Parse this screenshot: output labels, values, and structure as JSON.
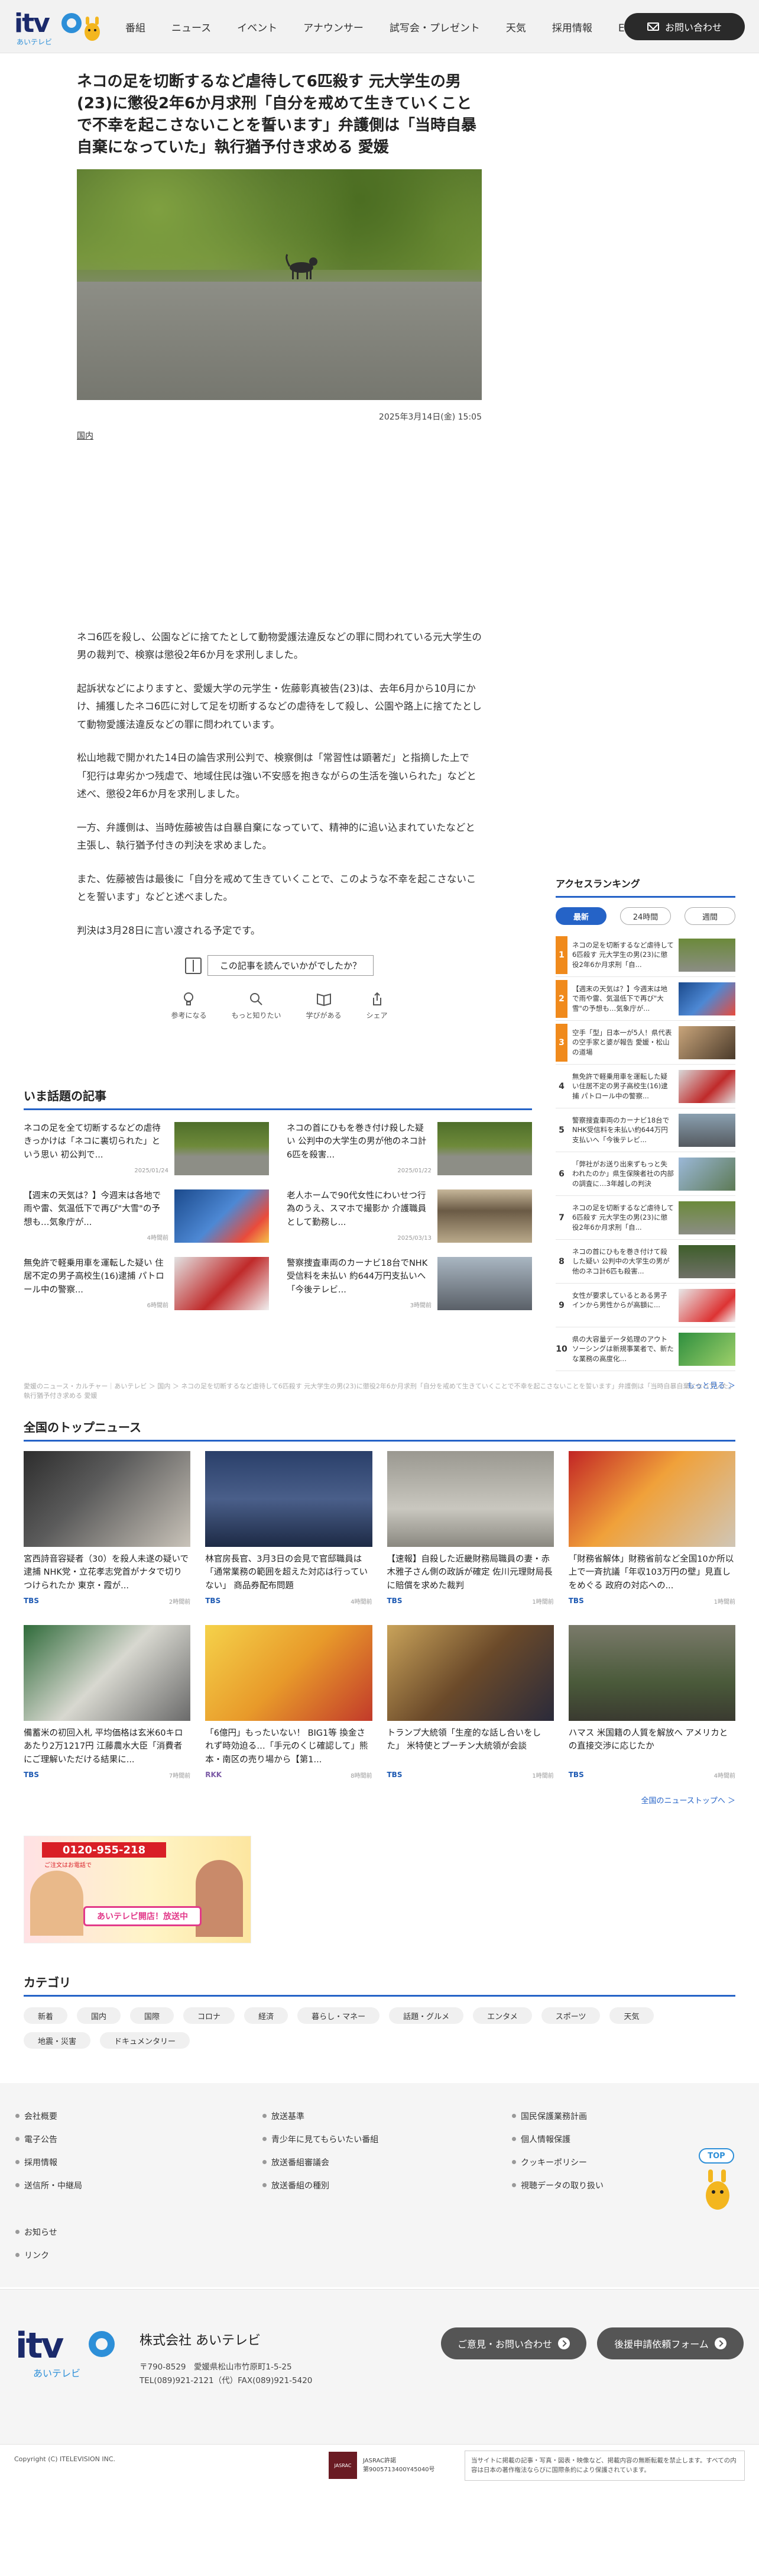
{
  "header": {
    "logo_text": "itv",
    "logo_sub": "あいテレビ",
    "nav": [
      "番組",
      "ニュース",
      "イベント",
      "アナウンサー",
      "試写会・プレゼント",
      "天気",
      "採用情報",
      "ECサイト"
    ],
    "contact": "お問い合わせ"
  },
  "article": {
    "title": "ネコの足を切断するなど虐待して6匹殺す 元大学生の男(23)に懲役2年6か月求刑「自分を戒めて生きていくことで不幸を起こさないことを誓います」弁護側は「当時自暴自棄になっていた」執行猶予付き求める 愛媛",
    "date": "2025年3月14日(金) 15:05",
    "category": "国内",
    "paragraphs": [
      "ネコ6匹を殺し、公園などに捨てたとして動物愛護法違反などの罪に問われている元大学生の男の裁判で、検察は懲役2年6か月を求刑しました。",
      "起訴状などによりますと、愛媛大学の元学生・佐藤彰真被告(23)は、去年6月から10月にかけ、捕獲したネコ6匹に対して足を切断するなどの虐待をして殺し、公園や路上に捨てたとして動物愛護法違反などの罪に問われています。",
      "松山地裁で開かれた14日の論告求刑公判で、検察側は「常習性は顕著だ」と指摘した上で「犯行は卑劣かつ残虐で、地域住民は強い不安感を抱きながらの生活を強いられた」などと述べ、懲役2年6か月を求刑しました。",
      "一方、弁護側は、当時佐藤被告は自暴自棄になっていて、精神的に追い込まれていたなどと主張し、執行猶予付きの判決を求めました。",
      "また、佐藤被告は最後に「自分を戒めて生きていくことで、このような不幸を起こさないことを誓います」などと述べました。",
      "判決は3月28日に言い渡される予定です。"
    ],
    "feedback_question": "この記事を読んでいかがでしたか？",
    "reactions": [
      "参考になる",
      "もっと知りたい",
      "学びがある",
      "シェア"
    ]
  },
  "ranking": {
    "title": "アクセスランキング",
    "tabs": [
      "最新",
      "24時間",
      "週間"
    ],
    "items": [
      {
        "rank": "1",
        "text": "ネコの足を切断するなど虐待して6匹殺す 元大学生の男(23)に懲役2年6か月求刑「自..."
      },
      {
        "rank": "2",
        "text": "【週末の天気は？】今週末は地で雨や雷、気温低下で再び\"大雪\"の予想も…気象庁が..."
      },
      {
        "rank": "3",
        "text": "空手「型」日本一が5人！県代表の空手家と婆が報告 愛媛・松山の道場"
      },
      {
        "rank": "4",
        "text": "無免許で軽乗用車を運転した疑い住居不定の男子高校生(16)逮捕 パトロール中の警察..."
      },
      {
        "rank": "5",
        "text": "警察搜査車両のカーナビ18台でNHK受信料を未払い約644万円支払いへ「今後テレビ..."
      },
      {
        "rank": "6",
        "text": "「弊社がお送り出来ずもっと失われたのか」県生保険者社の内部の調査に…3年越しの判決"
      },
      {
        "rank": "7",
        "text": "ネコの足を切断するなど虐待して6匹殺す 元大学生の男(23)に懲役2年6か月求刑「自..."
      },
      {
        "rank": "8",
        "text": "ネコの首にひもを巻き付けて殺した疑い 公判中の大学生の男が他のネコ計6匹も殺害..."
      },
      {
        "rank": "9",
        "text": "女性が要求しているとある男子インから男性からが高額に..."
      },
      {
        "rank": "10",
        "text": "県の大容量データ処理のアウトソーシングは新規事業者で、新たな業務の高度化…"
      }
    ],
    "more": "もっと見る ＞"
  },
  "trending": {
    "title": "いま話題の記事",
    "items": [
      {
        "text": "ネコの足を全て切断するなどの虐待 きっかけは「ネコに裏切られた」という思い 初公判で...",
        "date": "2025/01/24"
      },
      {
        "text": "ネコの首にひもを巻き付け殺した疑い 公判中の大学生の男が他のネコ計6匹を殺害...",
        "date": "2025/01/22"
      },
      {
        "text": "【週末の天気は？】今週末は各地で雨や雷、気温低下で再び\"大雪\"の予想も…気象庁が...",
        "date": "4時間前"
      },
      {
        "text": "老人ホームで90代女性にわいせつ行為のうえ、スマホで撮影か 介護職員として勤務し...",
        "date": "2025/03/13"
      },
      {
        "text": "無免許で軽乗用車を運転した疑い 住居不定の男子高校生(16)逮捕 パトロール中の警察...",
        "date": "6時間前"
      },
      {
        "text": "警察捜査車両のカーナビ18台でNHK受信料を未払い 約644万円支払いへ「今後テレビ...",
        "date": "3時間前"
      }
    ]
  },
  "note": "愛媛のニュース・カルチャー｜あいテレビ ＞ 国内 ＞ ネコの足を切断するなど虐待して6匹殺す 元大学生の男(23)に懲役2年6か月求刑「自分を戒めて生きていくことで不幸を起こさないことを誓います」弁護側は「当時自暴自棄になっていた」執行猶予付き求める 愛媛",
  "topnews": {
    "title": "全国のトップニュース",
    "items": [
      {
        "title": "宮西詩音容疑者（30）を殺人未遂の疑いで逮捕 NHK党・立花孝志党首がナタで切りつけられたか 東京・霞が...",
        "src": "TBS",
        "time": "2時間前"
      },
      {
        "title": "林官房長官、3月3日の会見で官邸職員は「通常業務の範囲を超えた対応は行っていない」 商品券配布問題",
        "src": "TBS",
        "time": "4時間前"
      },
      {
        "title": "【速報】自殺した近畿財務局職員の妻・赤木雅子さん側の政訴が確定 佐川元理財局長に賠償を求めた裁判",
        "src": "TBS",
        "time": "1時間前"
      },
      {
        "title": "「財務省解体」財務省前など全国10か所以上で一斉抗議「年収103万円の壁」見直しをめぐる 政府の対応への...",
        "src": "TBS",
        "time": "1時間前"
      },
      {
        "title": "備蓄米の初回入札 平均価格は玄米60キロあたり2万1217円 江藤農水大臣「消費者にご理解いただける結果に...",
        "src": "TBS",
        "time": "7時間前"
      },
      {
        "title": "「6億円」もったいない！ BIG1等 換金されず時効迫る…「手元のくじ確認して」熊本・南区の売り場から【第1...",
        "src": "RKK",
        "time": "8時間前"
      },
      {
        "title": "トランプ大統領「生産的な話し合いをした」 米特使とプーチン大統領が会談",
        "src": "TBS",
        "time": "1時間前"
      },
      {
        "title": "ハマス 米国籍の人質を解放へ アメリカとの直接交渉に応じたか",
        "src": "TBS",
        "time": "4時間前"
      }
    ],
    "more": "全国のニューストップへ ＞"
  },
  "banner": {
    "phone": "0120-955-218",
    "subtitle": "あいテレビ開店！放送中",
    "label": "ご注文はお電話で"
  },
  "category": {
    "title": "カテゴリ",
    "tags": [
      "新着",
      "国内",
      "国際",
      "コロナ",
      "経済",
      "暮らし・マネー",
      "話題・グルメ",
      "エンタメ",
      "スポーツ",
      "天気",
      "地震・災害",
      "ドキュメンタリー"
    ]
  },
  "footer": {
    "col1": [
      "会社概要",
      "電子公告",
      "採用情報",
      "送信所・中継局",
      "お知らせ",
      "リンク"
    ],
    "col2": [
      "放送基準",
      "青少年に見てもらいたい番組",
      "放送番組審議会",
      "放送番組の種別"
    ],
    "col3": [
      "国民保護業務計画",
      "個人情報保護",
      "クッキーポリシー",
      "視聴データの取り扱い"
    ],
    "top": "TOP",
    "company": "株式会社 あいテレビ",
    "address": "〒790-8529　愛媛県松山市竹原町1-5-25",
    "tel": "TEL(089)921-2121（代）FAX(089)921-5420",
    "btn_contact": "ご意見・お問い合わせ",
    "btn_form": "後援申請依頼フォーム",
    "copyright": "Copyright (C) ITELEVISION INC.",
    "jasrac_logo": "JASRAC",
    "jasrac_line1": "JASRAC許諾",
    "jasrac_line2": "第9005713400Y45040号",
    "notice": "当サイトに掲載の記事・写真・図表・映像など、掲載内容の無断転載を禁止します。すべての内容は日本の著作権法ならびに国際条約により保護されています。"
  }
}
